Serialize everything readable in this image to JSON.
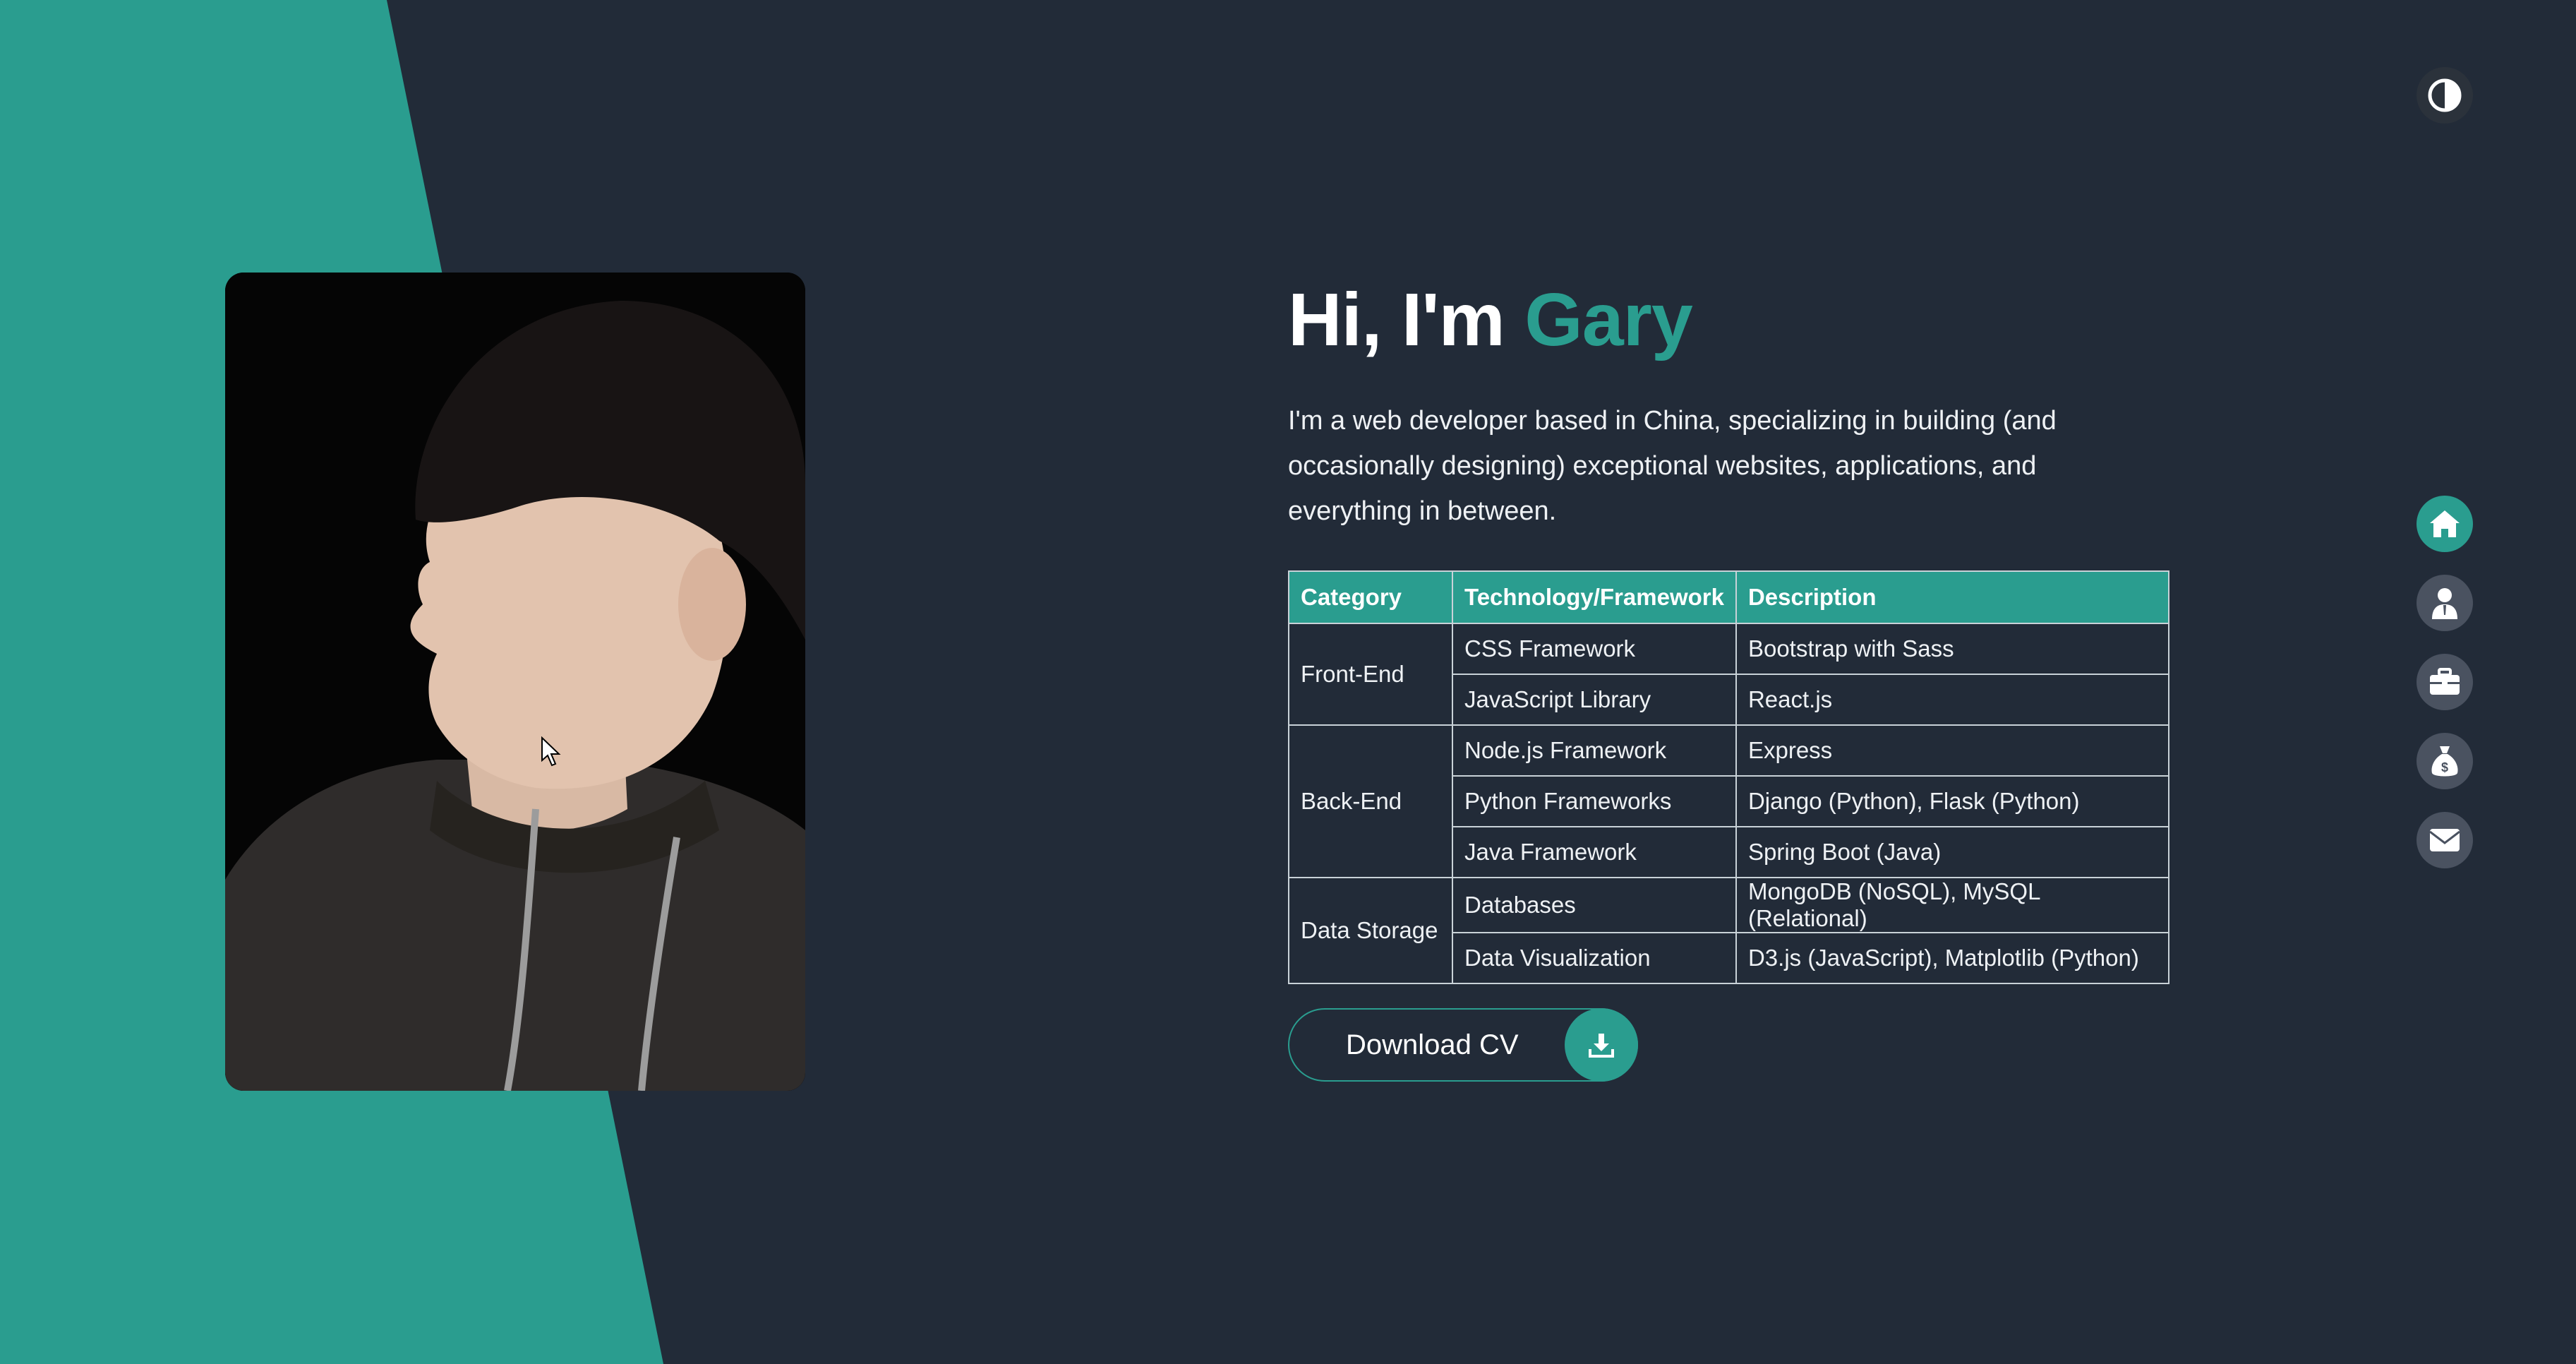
{
  "hero": {
    "greeting": "Hi, I'm ",
    "name": "Gary",
    "intro": "I'm a web developer based in China, specializing in building (and occasionally designing) exceptional websites, applications, and everything in between.",
    "photo_alt": "Portrait of Gary"
  },
  "colors": {
    "accent": "#2a9d8f",
    "background": "#222b38"
  },
  "table": {
    "headers": [
      "Category",
      "Technology/Framework",
      "Description"
    ],
    "groups": [
      {
        "category": "Front-End",
        "rows": [
          {
            "tech": "CSS Framework",
            "desc": "Bootstrap with Sass"
          },
          {
            "tech": "JavaScript Library",
            "desc": "React.js"
          }
        ]
      },
      {
        "category": "Back-End",
        "rows": [
          {
            "tech": "Node.js Framework",
            "desc": "Express"
          },
          {
            "tech": "Python Frameworks",
            "desc": "Django (Python), Flask (Python)"
          },
          {
            "tech": "Java Framework",
            "desc": "Spring Boot (Java)"
          }
        ]
      },
      {
        "category": "Data Storage",
        "rows": [
          {
            "tech": "Databases",
            "desc": "MongoDB (NoSQL), MySQL (Relational)"
          },
          {
            "tech": "Data Visualization",
            "desc": "D3.js (JavaScript), Matplotlib (Python)"
          }
        ]
      }
    ]
  },
  "cv_button": {
    "label": "Download CV",
    "icon": "download-icon"
  },
  "theme_toggle": {
    "icon": "contrast-icon"
  },
  "nav": [
    {
      "name": "home",
      "icon": "home-icon",
      "active": true
    },
    {
      "name": "about",
      "icon": "user-icon",
      "active": false
    },
    {
      "name": "portfolio",
      "icon": "briefcase-icon",
      "active": false
    },
    {
      "name": "services",
      "icon": "money-bag-icon",
      "active": false
    },
    {
      "name": "contact",
      "icon": "envelope-icon",
      "active": false
    }
  ]
}
